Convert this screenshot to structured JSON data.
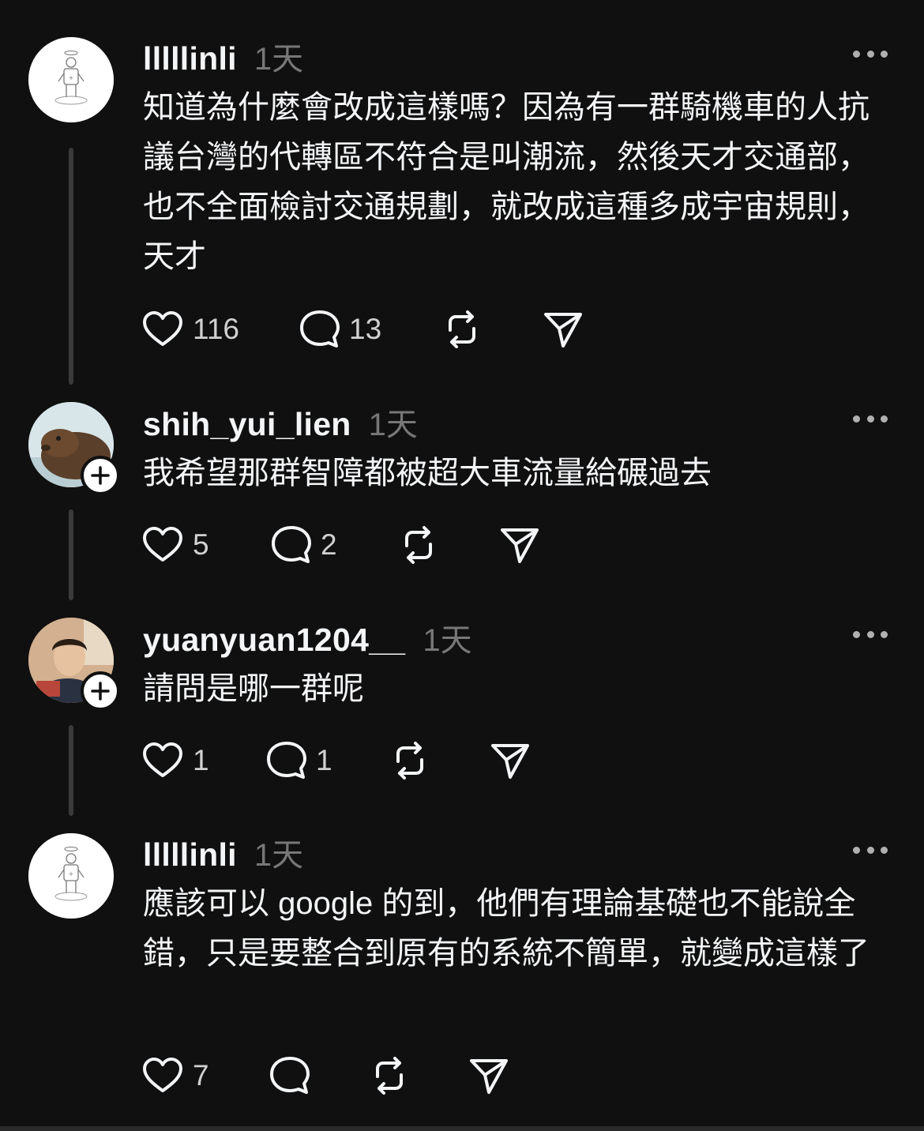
{
  "posts": [
    {
      "username": "lllllinli",
      "time": "1天",
      "text": "知道為什麼會改成這樣嗎？因為有一群騎機車的人抗議台灣的代轉區不符合是叫潮流，然後天才交通部，也不全面檢討交通規劃，就改成這種多成宇宙規則，天才",
      "avatar_icon": "sketch-figure-avatar",
      "likes": "116",
      "replies": "13"
    },
    {
      "username": "shih_yui_lien",
      "time": "1天",
      "text": "我希望那群智障都被超大車流量給碾過去",
      "avatar_icon": "capybara-avatar",
      "likes": "5",
      "replies": "2"
    },
    {
      "username": "yuanyuan1204__",
      "time": "1天",
      "text": "請問是哪一群呢",
      "avatar_icon": "person-photo-avatar",
      "likes": "1",
      "replies": "1"
    },
    {
      "username": "lllllinli",
      "time": "1天",
      "text": "應該可以 google 的到，他們有理論基礎也不能說全錯，只是要整合到原有的系統不簡單，就變成這樣了",
      "avatar_icon": "sketch-figure-avatar",
      "likes": "7",
      "replies": ""
    }
  ],
  "colors": {
    "background": "#101010",
    "text": "#f3f5f7",
    "secondary": "#777777",
    "thread_line": "#3a3a3a"
  }
}
